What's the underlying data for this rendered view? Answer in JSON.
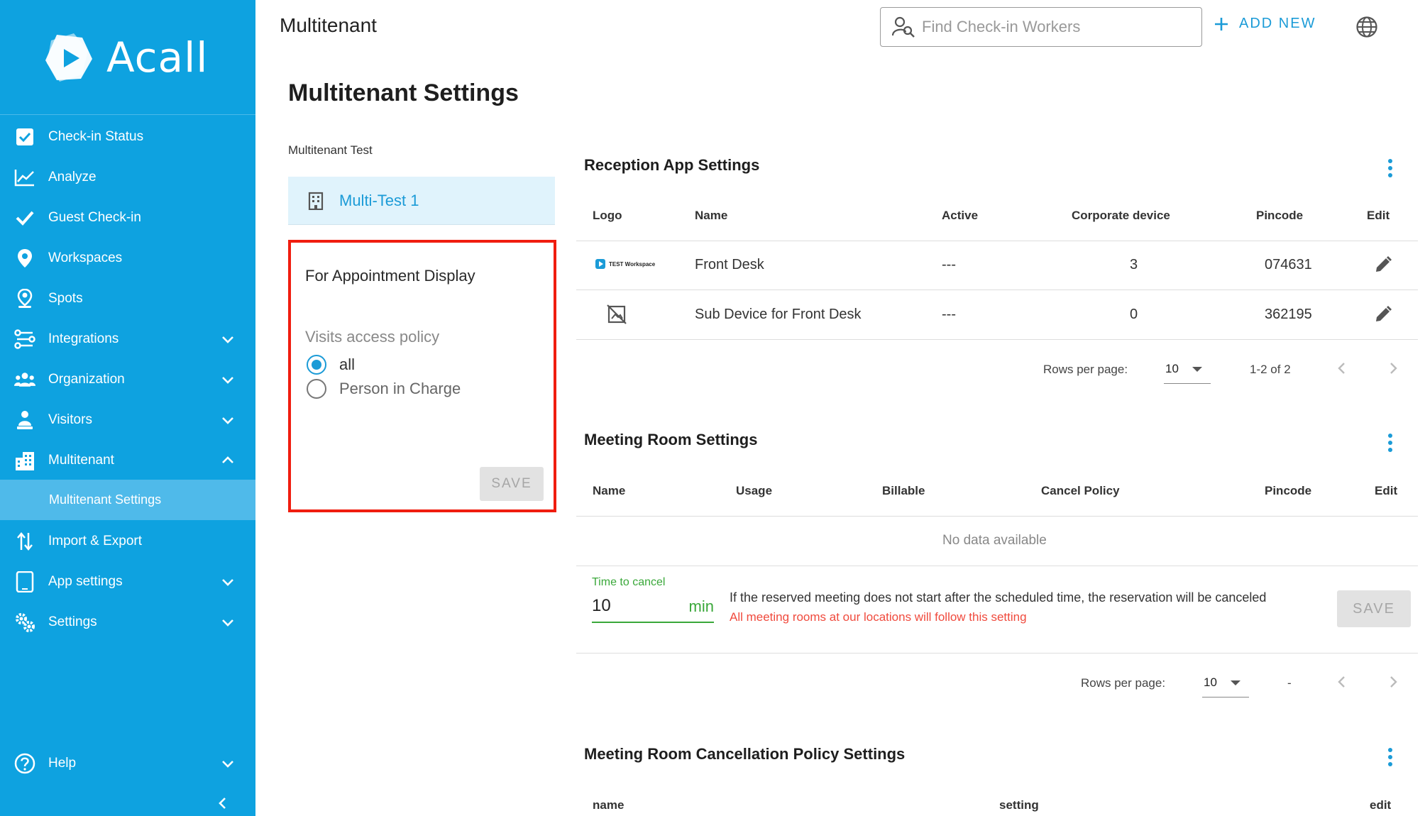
{
  "brand": {
    "name": "Acall"
  },
  "sidebar": {
    "items": [
      {
        "label": "Check-in Status",
        "icon": "checkbox-icon"
      },
      {
        "label": "Analyze",
        "icon": "chart-line-icon"
      },
      {
        "label": "Guest Check-in",
        "icon": "check-icon"
      },
      {
        "label": "Workspaces",
        "icon": "map-pin-icon"
      },
      {
        "label": "Spots",
        "icon": "pin-person-icon"
      },
      {
        "label": "Integrations",
        "icon": "integrations-icon"
      },
      {
        "label": "Organization",
        "icon": "people-icon"
      },
      {
        "label": "Visitors",
        "icon": "visitor-icon"
      },
      {
        "label": "Multitenant",
        "icon": "building-icon"
      },
      {
        "label": "Import & Export",
        "icon": "import-export-icon"
      },
      {
        "label": "App settings",
        "icon": "tablet-icon"
      },
      {
        "label": "Settings",
        "icon": "gears-icon"
      },
      {
        "label": "Help",
        "icon": "help-icon"
      }
    ],
    "sub_item": "Multitenant Settings"
  },
  "header": {
    "title": "Multitenant",
    "search_placeholder": "Find Check-in Workers",
    "add_new": "ADD NEW"
  },
  "page": {
    "title": "Multitenant Settings"
  },
  "tenant": {
    "label": "Multitenant Test",
    "selected": "Multi-Test 1"
  },
  "appointment": {
    "title": "For Appointment Display",
    "policy_label": "Visits access policy",
    "options": [
      "all",
      "Person in Charge"
    ],
    "selected": "all",
    "save": "SAVE"
  },
  "reception": {
    "title": "Reception App Settings",
    "columns": [
      "Logo",
      "Name",
      "Active",
      "Corporate device",
      "Pincode",
      "Edit"
    ],
    "rows": [
      {
        "logo_text": "TEST Workspace",
        "name": "Front Desk",
        "active": "---",
        "corporate": "3",
        "pincode": "074631"
      },
      {
        "logo_text": "",
        "name": "Sub Device for Front Desk",
        "active": "---",
        "corporate": "0",
        "pincode": "362195"
      }
    ],
    "rows_per_page_label": "Rows per page:",
    "rows_per_page": "10",
    "range": "1-2 of 2"
  },
  "meeting": {
    "title": "Meeting Room Settings",
    "columns": [
      "Name",
      "Usage",
      "Billable",
      "Cancel Policy",
      "Pincode",
      "Edit"
    ],
    "empty": "No data available",
    "time_label": "Time to cancel",
    "time_value": "10",
    "time_unit": "min",
    "note": "If the reserved meeting does not start after the scheduled time, the reservation will be canceled",
    "warning": "All meeting rooms at our locations will follow this setting",
    "save": "SAVE",
    "rows_per_page_label": "Rows per page:",
    "rows_per_page": "10",
    "range": "-"
  },
  "cancellation": {
    "title": "Meeting Room Cancellation Policy Settings",
    "columns": [
      "name",
      "setting",
      "edit"
    ]
  }
}
